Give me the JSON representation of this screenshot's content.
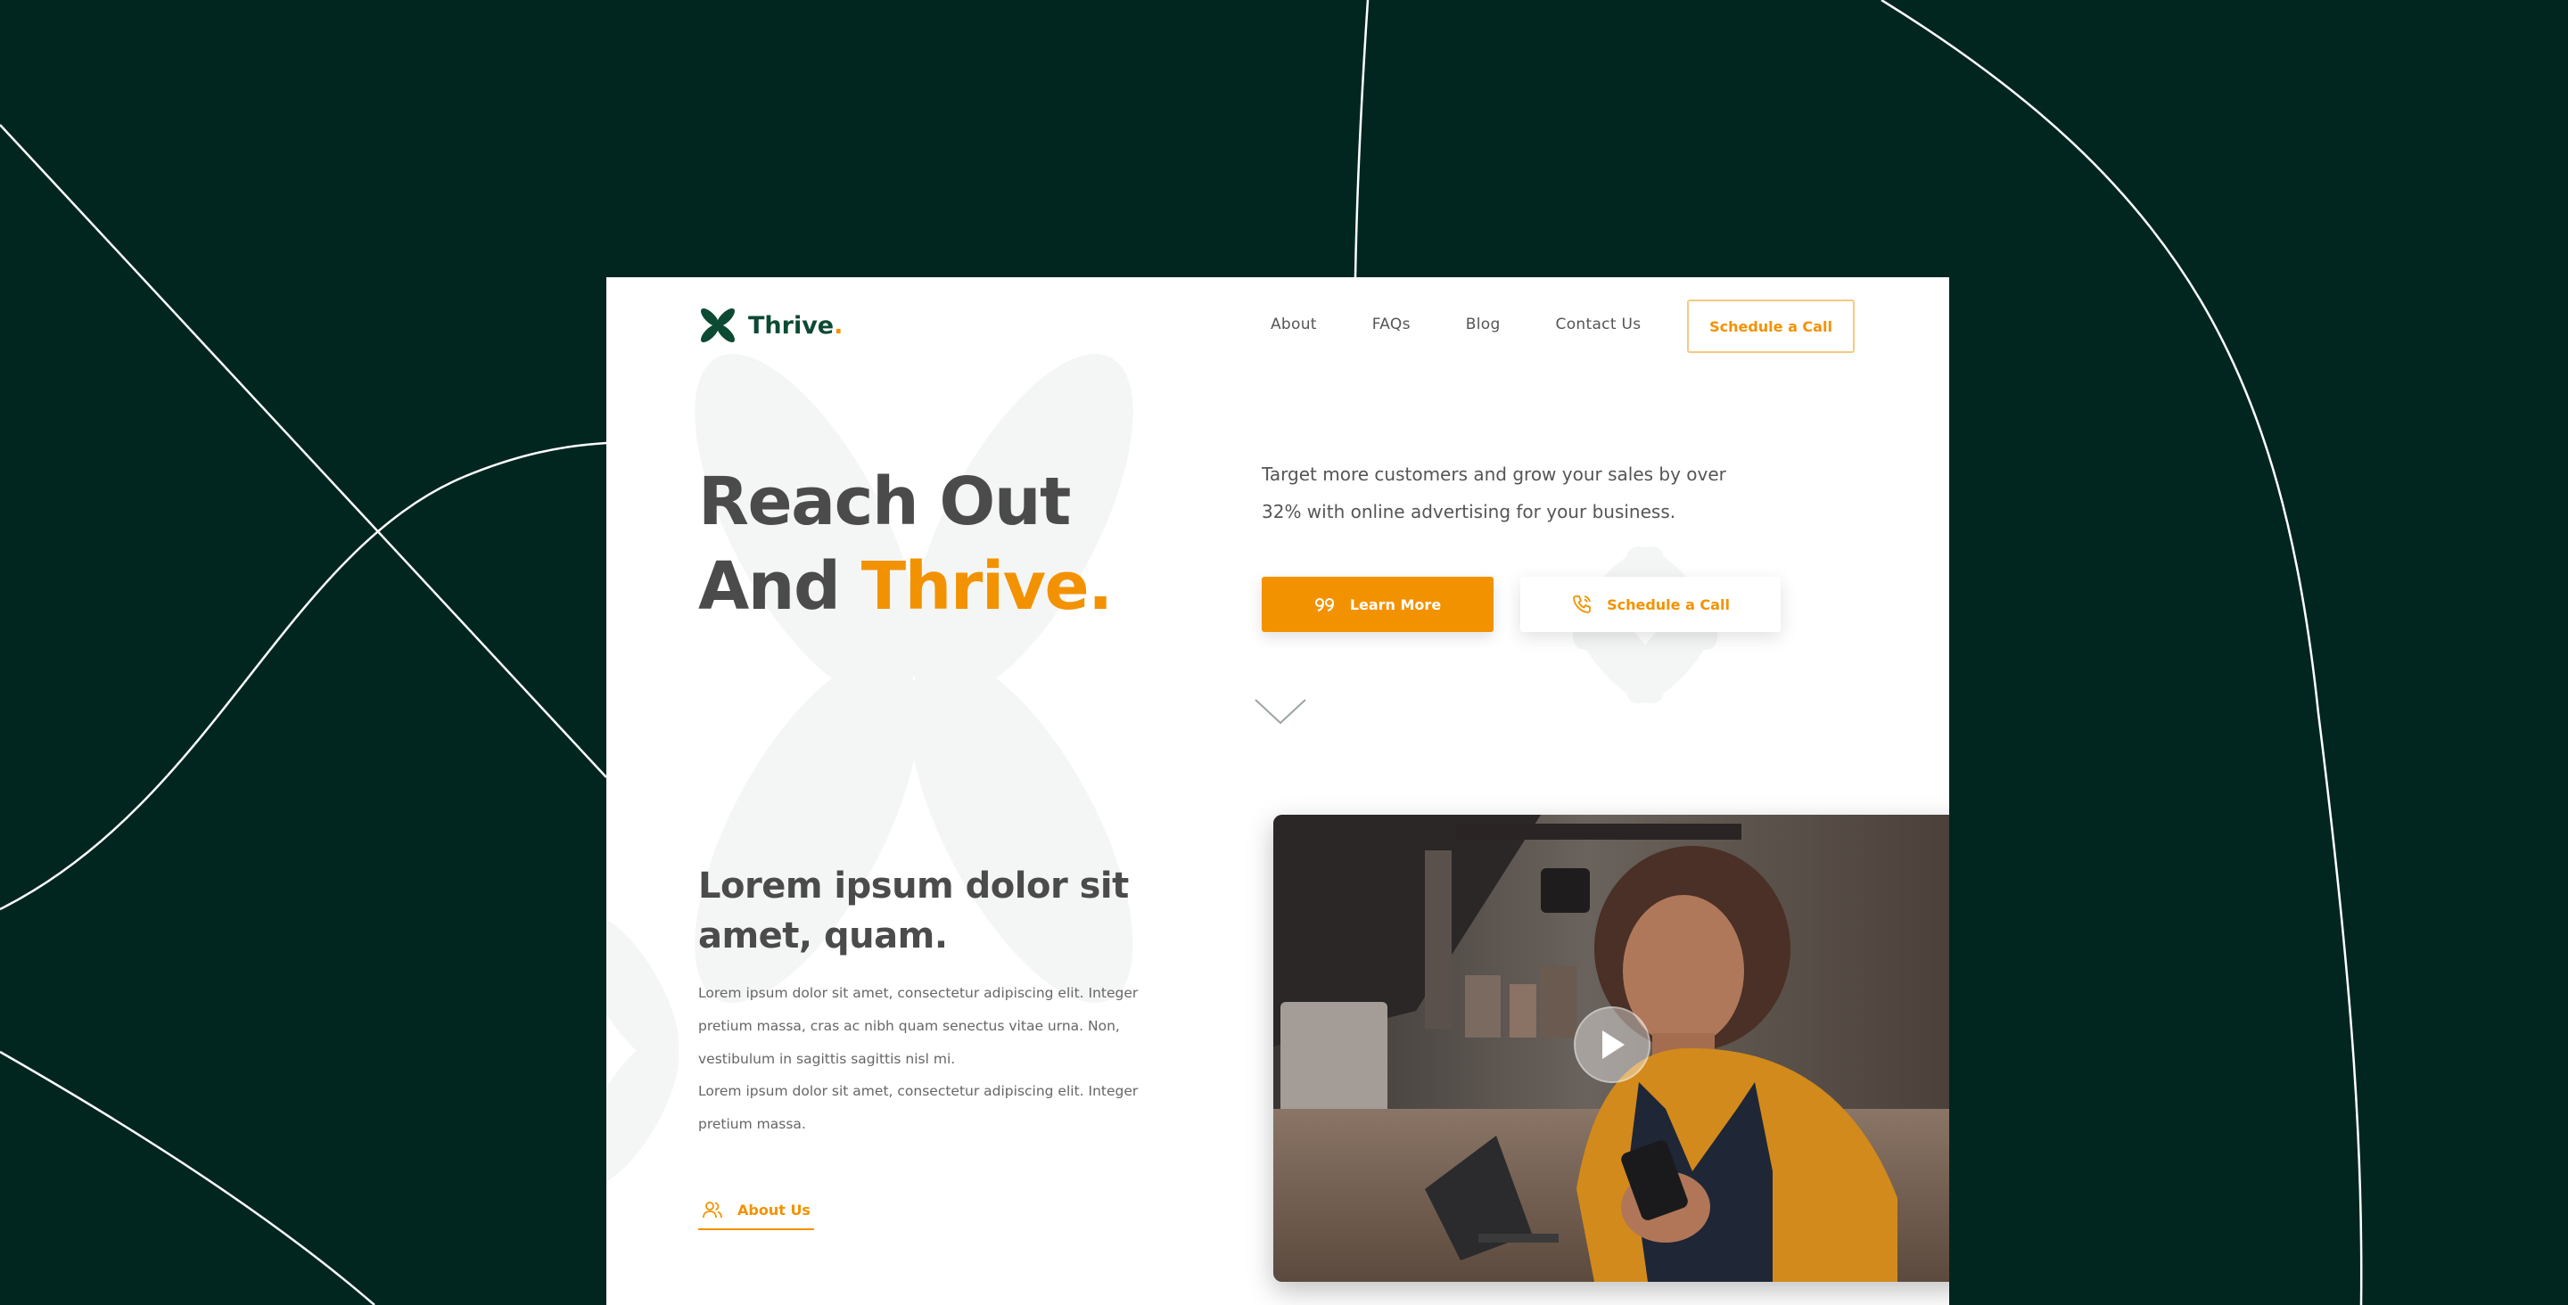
{
  "brand": {
    "name": "Thrive",
    "dot": ".",
    "primary": "#0d4a33",
    "accent": "#f39200",
    "backdrop": "#012620"
  },
  "nav": {
    "links": [
      "About",
      "FAQs",
      "Blog",
      "Contact Us"
    ],
    "cta": "Schedule a Call"
  },
  "hero": {
    "line1": "Reach Out",
    "line2_prefix": "And ",
    "line2_accent": "Thrive.",
    "subtitle": "Target more customers and grow your sales by over 32% with online advertising for your business.",
    "primary_button": {
      "label": "Learn More",
      "icon": "quote-icon"
    },
    "secondary_button": {
      "label": "Schedule a Call",
      "icon": "phone-icon"
    },
    "scroll_icon": "chevron-down-icon"
  },
  "section": {
    "title": "Lorem ipsum dolor sit amet, quam.",
    "paragraph1": "Lorem ipsum dolor sit amet, consectetur adipiscing elit. Integer pretium massa, cras ac nibh quam senectus vitae urna. Non, vestibulum in sagittis sagittis nisl mi.",
    "paragraph2": "Lorem ipsum dolor sit amet, consectetur adipiscing elit. Integer pretium massa.",
    "link": {
      "label": "About Us",
      "icon": "users-icon"
    }
  },
  "video": {
    "play_icon": "play-icon"
  }
}
